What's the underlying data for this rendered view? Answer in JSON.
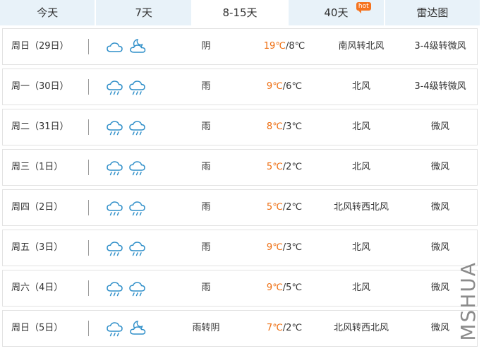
{
  "tabs": [
    {
      "label": "今天",
      "active": false
    },
    {
      "label": "7天",
      "active": false
    },
    {
      "label": "8-15天",
      "active": true
    },
    {
      "label": "40天",
      "active": false,
      "badge": "hot"
    },
    {
      "label": "雷达图",
      "active": false
    }
  ],
  "colors": {
    "high_temp": "#ee6d0f",
    "icon": "#2f8fc9",
    "tab_bg": "#e8f2f9"
  },
  "days": [
    {
      "day": "周日（29日）",
      "icons": [
        "cloudy-icon",
        "moon-cloud-icon"
      ],
      "condition": "阴",
      "high": "19℃",
      "low": "/8℃",
      "wind": "南风转北风",
      "force": "3-4级转微风"
    },
    {
      "day": "周一（30日）",
      "icons": [
        "rain-icon",
        "rain-icon"
      ],
      "condition": "雨",
      "high": "9℃",
      "low": "/6℃",
      "wind": "北风",
      "force": "3-4级转微风"
    },
    {
      "day": "周二（31日）",
      "icons": [
        "rain-icon",
        "rain-icon"
      ],
      "condition": "雨",
      "high": "8℃",
      "low": "/3℃",
      "wind": "北风",
      "force": "微风"
    },
    {
      "day": "周三（1日）",
      "icons": [
        "rain-icon",
        "rain-icon"
      ],
      "condition": "雨",
      "high": "5℃",
      "low": "/2℃",
      "wind": "北风",
      "force": "微风"
    },
    {
      "day": "周四（2日）",
      "icons": [
        "rain-icon",
        "rain-icon"
      ],
      "condition": "雨",
      "high": "5℃",
      "low": "/2℃",
      "wind": "北风转西北风",
      "force": "微风"
    },
    {
      "day": "周五（3日）",
      "icons": [
        "rain-icon",
        "rain-icon"
      ],
      "condition": "雨",
      "high": "9℃",
      "low": "/3℃",
      "wind": "北风",
      "force": "微风"
    },
    {
      "day": "周六（4日）",
      "icons": [
        "rain-icon",
        "rain-icon"
      ],
      "condition": "雨",
      "high": "9℃",
      "low": "/5℃",
      "wind": "北风",
      "force": "微风"
    },
    {
      "day": "周日（5日）",
      "icons": [
        "rain-icon",
        "moon-cloud-icon"
      ],
      "condition": "雨转阴",
      "high": "7℃",
      "low": "/2℃",
      "wind": "北风转西北风",
      "force": "微风"
    }
  ],
  "watermark": "MSHUA"
}
